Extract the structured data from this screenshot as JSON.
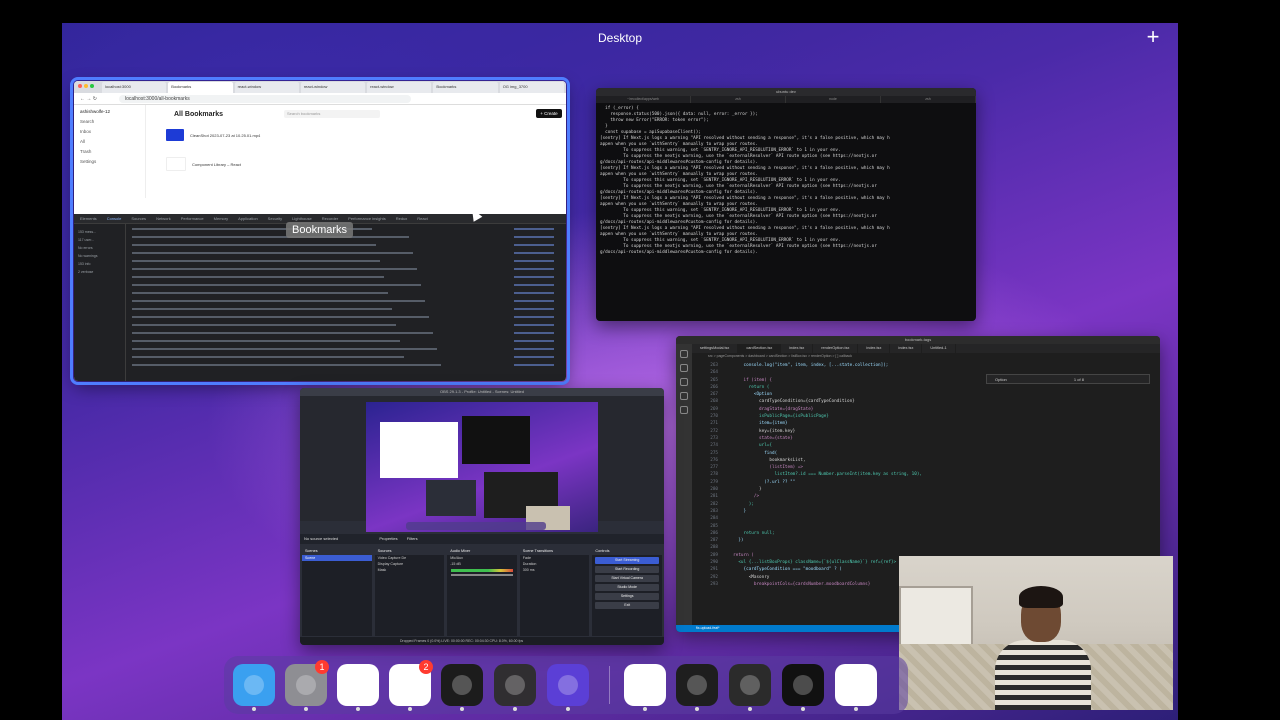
{
  "desktop": {
    "label": "Desktop",
    "add_space": "+"
  },
  "chrome": {
    "tabs": [
      "localhost:3000",
      "Bookmarks",
      "react-window",
      "react-window",
      "react-window",
      "Bookmarks",
      "OG img_3700"
    ],
    "url": "localhost:3000/all-bookmarks",
    "page": {
      "user": "ashishwolfe-12",
      "title": "All Bookmarks",
      "search_placeholder": "Search bookmarks",
      "create_label": "+ Create",
      "sidebar": [
        "Search",
        "Inbox",
        "All",
        "Trash",
        "Settings"
      ],
      "items": [
        {
          "title": "CleanShot 2023-07-23 at 10.25.01.mp4"
        },
        {
          "title": "Component Library – React"
        }
      ]
    },
    "devtools_tabs": [
      "Elements",
      "Console",
      "Sources",
      "Network",
      "Performance",
      "Memory",
      "Application",
      "Security",
      "Lighthouse",
      "Recorder",
      "Performance insights",
      "Redux",
      "React"
    ],
    "devtools_active": "Console",
    "devtools_left": [
      "153 mess...",
      "117 user...",
      "No errors",
      "No warnings",
      "153 info",
      "2 verbose"
    ],
    "tooltip": "Bookmarks"
  },
  "terminal": {
    "title": "ubuntu dev",
    "tabs": [
      "~/recollect/apps/web",
      "zsh",
      "node",
      "zsh"
    ],
    "lines": [
      "  if (_error) {",
      "    response.status(500).json({ data: null, error: _error });",
      "    throw new Error(\"ERROR: token error\");",
      "  }",
      "",
      "  const supabase = apiSupabaseClient();",
      "[sentry] If Next.js logs a warning \"API resolved without sending a response\", it's a false positive, which may h",
      "appen when you use `withSentry` manually to wrap your routes.",
      "         To suppress this warning, set `SENTRY_IGNORE_API_RESOLUTION_ERROR` to 1 in your env.",
      "         To suppress the nextjs warning, use the `externalResolver` API route option (see https://nextjs.or",
      "g/docs/api-routes/api-middlewares#custom-config for details).",
      "[sentry] If Next.js logs a warning \"API resolved without sending a response\", it's a false positive, which may h",
      "appen when you use `withSentry` manually to wrap your routes.",
      "         To suppress this warning, set `SENTRY_IGNORE_API_RESOLUTION_ERROR` to 1 in your env.",
      "         To suppress the nextjs warning, use the `externalResolver` API route option (see https://nextjs.or",
      "g/docs/api-routes/api-middlewares#custom-config for details).",
      "[sentry] If Next.js logs a warning \"API resolved without sending a response\", it's a false positive, which may h",
      "appen when you use `withSentry` manually to wrap your routes.",
      "         To suppress this warning, set `SENTRY_IGNORE_API_RESOLUTION_ERROR` to 1 in your env.",
      "         To suppress the nextjs warning, use the `externalResolver` API route option (see https://nextjs.or",
      "g/docs/api-routes/api-middlewares#custom-config for details).",
      "[sentry] If Next.js logs a warning \"API resolved without sending a response\", it's a false positive, which may h",
      "appen when you use `withSentry` manually to wrap your routes.",
      "         To suppress this warning, set `SENTRY_IGNORE_API_RESOLUTION_ERROR` to 1 in your env.",
      "         To suppress the nextjs warning, use the `externalResolver` API route option (see https://nextjs.or",
      "g/docs/api-routes/api-middlewares#custom-config for details)."
    ]
  },
  "vscode": {
    "title": "bookmark-tags",
    "tabs": [
      "settingsModal.tsx",
      "cardSection.tsx",
      "index.tsx",
      "renderOption.tsx",
      "index.tsx",
      "index.tsx",
      "Untitled-1"
    ],
    "breadcrumb": "src > pageComponents > dashboard > cardSection > listBox.tsx > renderOption > [ ] callback",
    "find_text": "Option",
    "find_count": "1 of 8",
    "status": "fix-upload-feat*",
    "lines": [
      {
        "n": "263",
        "code": "      console.log(\"item\", item, index, [...state.collection]);"
      },
      {
        "n": "264",
        "code": ""
      },
      {
        "n": "265",
        "code": "      if (item) {"
      },
      {
        "n": "266",
        "code": "        return ("
      },
      {
        "n": "267",
        "code": "          <Option"
      },
      {
        "n": "268",
        "code": "            cardTypeCondition={cardTypeCondition}"
      },
      {
        "n": "269",
        "code": "            dragState={dragState}"
      },
      {
        "n": "270",
        "code": "            isPublicPage={isPublicPage}"
      },
      {
        "n": "271",
        "code": "            item={item}"
      },
      {
        "n": "272",
        "code": "            key={item.key}"
      },
      {
        "n": "273",
        "code": "            state={state}"
      },
      {
        "n": "274",
        "code": "            url={"
      },
      {
        "n": "275",
        "code": "              find("
      },
      {
        "n": "276",
        "code": "                bookmarksList,"
      },
      {
        "n": "277",
        "code": "                (listItem) =>"
      },
      {
        "n": "278",
        "code": "                  listItem?.id === Number.parseInt(item.key as string, 10),"
      },
      {
        "n": "279",
        "code": "              )?.url ?? \"\""
      },
      {
        "n": "280",
        "code": "            }"
      },
      {
        "n": "281",
        "code": "          />"
      },
      {
        "n": "282",
        "code": "        );"
      },
      {
        "n": "283",
        "code": "      }"
      },
      {
        "n": "284",
        "code": ""
      },
      {
        "n": "285",
        "code": ""
      },
      {
        "n": "286",
        "code": "      return null;"
      },
      {
        "n": "287",
        "code": "    })"
      },
      {
        "n": "288",
        "code": ""
      },
      {
        "n": "289",
        "code": "  return ("
      },
      {
        "n": "290",
        "code": "    <ul {...listBoxProps} className={`${ulClassName}`} ref={ref}>"
      },
      {
        "n": "291",
        "code": "      {cardTypeCondition === \"moodboard\" ? ("
      },
      {
        "n": "292",
        "code": "        <Masonry"
      },
      {
        "n": "293",
        "code": "          breakpointCols={cardsNumber.moodboardColumns}"
      }
    ]
  },
  "obs": {
    "title": "OBS 29.1.3 - Profile: Untitled - Scenes: Untitled",
    "bar": "No source selected",
    "properties": "Properties",
    "filters": "Filters",
    "docks": {
      "scenes": {
        "title": "Scenes",
        "items": [
          "Scene"
        ]
      },
      "sources": {
        "title": "Sources",
        "items": [
          "Video Capture De",
          "Display Capture",
          "Mask"
        ]
      },
      "mixer": {
        "title": "Audio Mixer",
        "items": [
          "Mic/Aux",
          "-15 dB"
        ]
      },
      "transitions": {
        "title": "Scene Transitions",
        "items": [
          "Fade",
          "Duration",
          "300 ms"
        ]
      },
      "controls": {
        "title": "Controls",
        "buttons": [
          "Start Streaming",
          "Start Recording",
          "Start Virtual Camera",
          "Studio Mode",
          "Settings",
          "Exit"
        ]
      }
    },
    "status": "Dropped Frames 0 (0.0%)    LIVE: 00:00:00    REC: 00:04:30    CPU: 8.0%, 60.00 fps"
  },
  "dock": {
    "apps": [
      {
        "name": "Finder",
        "icon": "finder-icon",
        "color": "#3aa0f0"
      },
      {
        "name": "System Settings",
        "icon": "gear-icon",
        "color": "#8e8e93",
        "badge": "1"
      },
      {
        "name": "Chrome",
        "icon": "chrome-icon",
        "color": "#ffffff"
      },
      {
        "name": "Slack",
        "icon": "slack-icon",
        "color": "#ffffff",
        "badge": "2"
      },
      {
        "name": "iTerm",
        "icon": "terminal-icon",
        "color": "#1c1c1c"
      },
      {
        "name": "OBS",
        "icon": "obs-icon",
        "color": "#302e31"
      },
      {
        "name": "Elpass",
        "icon": "star-icon",
        "color": "#5b3fd6"
      },
      {
        "name": "VS Code",
        "icon": "vscode-icon",
        "color": "#ffffff"
      },
      {
        "name": "Figma",
        "icon": "figma-icon",
        "color": "#1e1e1e"
      },
      {
        "name": "Terminal",
        "icon": "terminal-icon",
        "color": "#2b2b2b"
      },
      {
        "name": "Spotify",
        "icon": "spotify-icon",
        "color": "#111111"
      },
      {
        "name": "Notes",
        "icon": "notes-icon",
        "color": "#ffffff"
      }
    ]
  }
}
